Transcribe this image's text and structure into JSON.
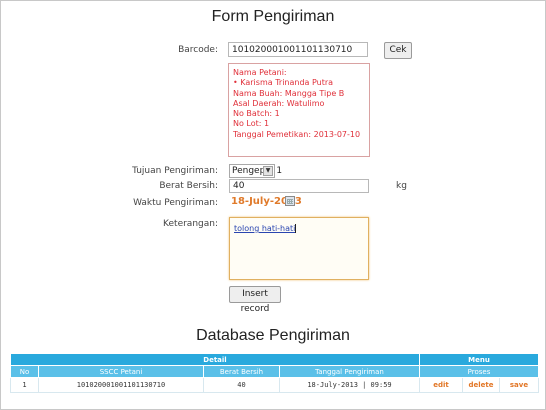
{
  "form": {
    "title": "Form Pengiriman",
    "barcode_label": "Barcode:",
    "barcode_value": "101020001001101130710",
    "cek_button": "Cek",
    "info_lines": [
      "Nama Petani:",
      "• Karisma Trinanda Putra",
      "Nama Buah: Mangga Tipe B",
      "Asal Daerah: Watulimo",
      "No Batch: 1",
      "No Lot: 1",
      "Tanggal Pemetikan: 2013-07-10"
    ],
    "tujuan_label": "Tujuan Pengiriman:",
    "tujuan_value": "Pengepul 1",
    "berat_label": "Berat Bersih:",
    "berat_value": "40",
    "berat_unit": "kg",
    "waktu_label": "Waktu Pengiriman:",
    "waktu_value": "18-July-2013",
    "keterangan_label": "Keterangan:",
    "keterangan_value": "tolong hati-hati",
    "insert_button": "Insert record"
  },
  "database": {
    "title": "Database Pengiriman",
    "group_detail": "Detail",
    "group_menu": "Menu",
    "headers": [
      "No",
      "SSCC Petani",
      "Berat Bersih",
      "Tanggal Pengiriman"
    ],
    "proses_header": "Proses",
    "rows": [
      {
        "no": "1",
        "sscc": "101020001001101130710",
        "berat": "40",
        "tanggal": "18-July-2013 | 09:59",
        "actions": [
          "edit",
          "delete",
          "save"
        ]
      }
    ]
  }
}
